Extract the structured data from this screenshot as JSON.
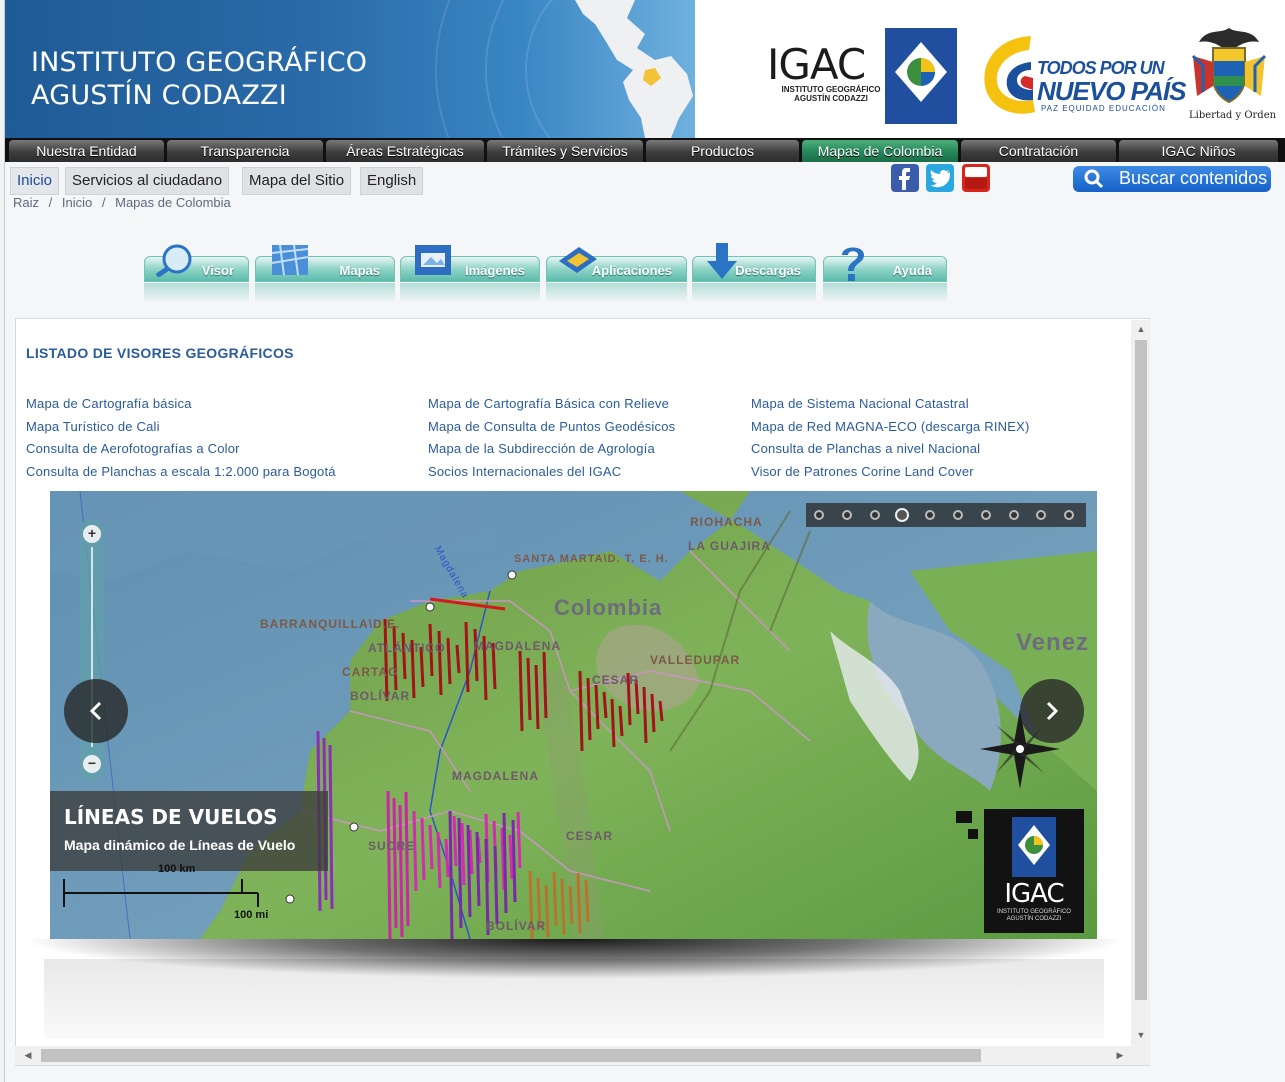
{
  "header": {
    "title_line1": "INSTITUTO GEOGRÁFICO",
    "title_line2": "AGUSTÍN CODAZZI",
    "igac_logo_text": "IGAC",
    "igac_logo_sub": "INSTITUTO GEOGRÁFICO AGUSTÍN CODAZZI",
    "campaign_line1": "TODOS POR UN",
    "campaign_line2": "NUEVO PAÍS",
    "campaign_line3": "PAZ  EQUIDAD  EDUCACIÓN",
    "escudo_motto": "Libertad y Orden"
  },
  "nav": {
    "items": [
      {
        "label": "Nuestra Entidad"
      },
      {
        "label": "Transparencia"
      },
      {
        "label": "Áreas Estratégicas"
      },
      {
        "label": "Trámites y Servicios"
      },
      {
        "label": "Productos"
      },
      {
        "label": "Mapas de Colombia"
      },
      {
        "label": "Contratación"
      },
      {
        "label": "IGAC Niños"
      }
    ],
    "active": "Mapas de Colombia"
  },
  "sublinks": {
    "inicio": "Inicio",
    "servicios": "Servicios al ciudadano",
    "mapa_sitio": "Mapa del Sitio",
    "english": "English"
  },
  "breadcrumb": {
    "raiz": "Raiz",
    "sep": "/",
    "inicio": "Inicio",
    "current": "Mapas de Colombia"
  },
  "social": {
    "icons": [
      "facebook-icon",
      "twitter-icon",
      "youtube-icon"
    ],
    "youtube_text": "You Tube"
  },
  "search": {
    "label": "Buscar contenidos"
  },
  "sections": {
    "visor": "Visor",
    "mapas": "Mapas",
    "imagenes": "Imágenes",
    "aplicaciones": "Aplicaciones",
    "descargas": "Descargas",
    "ayuda": "Ayuda"
  },
  "listing": {
    "title": "LISTADO DE VISORES GEOGRÁFICOS",
    "col1": [
      "Mapa de Cartografía básica",
      "Mapa Turístico de Cali",
      "Consulta de Aerofotografías a Color",
      "Consulta de Planchas a escala 1:2.000 para Bogotá"
    ],
    "col2": [
      "Mapa de Cartografía Básica con Relieve",
      "Mapa de Consulta de Puntos Geodésicos",
      "Mapa de la Subdirección de Agrología",
      "Socios Internacionales del IGAC"
    ],
    "col3": [
      "Mapa de Sistema Nacional Catastral",
      "Mapa de Red MAGNA-ECO (descarga RINEX)",
      "Consulta de Planchas a nivel Nacional",
      "Visor de Patrones Corine Land Cover"
    ]
  },
  "slider": {
    "slide_title": "LÍNEAS DE VUELOS",
    "slide_subtitle": "Mapa dinámico de Líneas de Vuelo",
    "dot_count": 10,
    "active_dot": 4,
    "prev_label": "‹",
    "next_label": "›",
    "zoom_in": "+",
    "zoom_out": "−",
    "scale_km": "100 km",
    "scale_mi": "100 mi",
    "corner_logo_text": "IGAC",
    "corner_logo_sub": "INSTITUTO GEOGRÁFICO AGUSTÍN CODAZZI",
    "map_labels": {
      "riohacha": "RIOHACHA",
      "la_guajira": "LA GUAJIRA",
      "santa_marta": "SANTA MARTA\\D. T. E. H.",
      "colombia": "Colombia",
      "barranquilla": "BARRANQUILLA\\D.E.",
      "atlantico": "ATLÁNTICO",
      "magdalena_top": "MAGDALENA",
      "valledupar": "VALLEDUPAR",
      "cesar_top": "CESAR",
      "venez": "Venez",
      "bolivar_top": "BOLÍVAR",
      "magdalena_mid": "MAGDALENA",
      "cesar_bottom": "CESAR",
      "sucre": "SUCRE",
      "bolivar_bottom": "BOLÍVAR",
      "cartagena": "CARTAG",
      "river": "Magdalena"
    }
  },
  "colors": {
    "nav_active": "#23865a",
    "link": "#2a5b9c",
    "banner_blue": "#2a6aa8"
  }
}
